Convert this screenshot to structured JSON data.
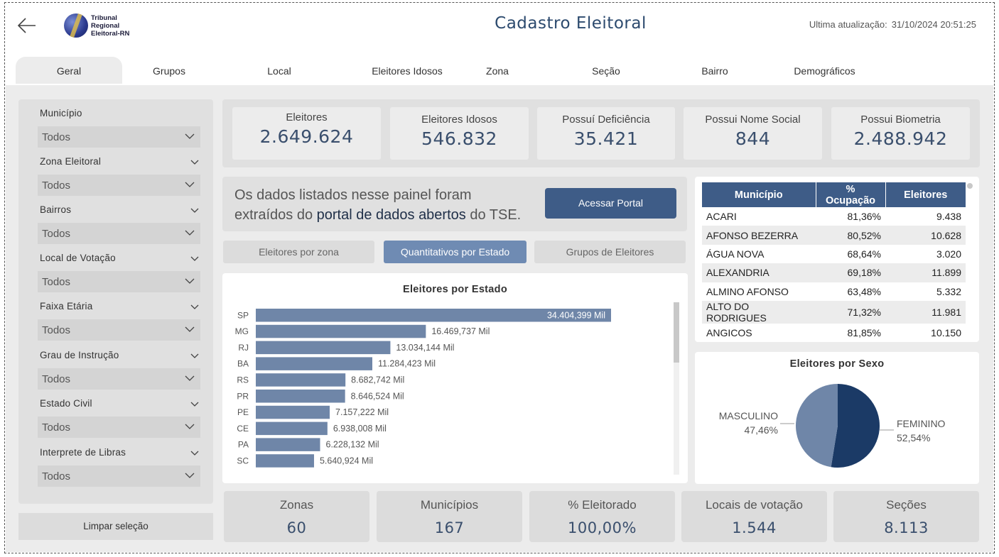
{
  "header": {
    "title": "Cadastro Eleitoral",
    "last_update_label": "Ultima atualização:",
    "last_update_value": "31/10/2024 20:51:25",
    "logo_lines": [
      "Tribunal",
      "Regional",
      "Eleitoral-RN"
    ]
  },
  "tabs": [
    "Geral",
    "Grupos",
    "Local",
    "Eleitores Idosos",
    "Zona",
    "Seção",
    "Bairro",
    "Demográficos"
  ],
  "filters": [
    {
      "label": "Município",
      "value": "Todos"
    },
    {
      "label": "Zona Eleitoral",
      "value": "Todos"
    },
    {
      "label": "Bairros",
      "value": "Todos"
    },
    {
      "label": "Local de Votação",
      "value": "Todos"
    },
    {
      "label": "Faixa Etária",
      "value": "Todos"
    },
    {
      "label": "Grau de Instrução",
      "value": "Todos"
    },
    {
      "label": "Estado Civil",
      "value": "Todos"
    },
    {
      "label": "Interprete de Libras",
      "value": "Todos"
    }
  ],
  "clear_button": "Limpar seleção",
  "kpis_top": [
    {
      "label": "Eleitores",
      "value": "2.649.624"
    },
    {
      "label": "Eleitores Idosos",
      "value": "546.832"
    },
    {
      "label": "Possuí Deficiência",
      "value": "35.421"
    },
    {
      "label": "Possui Nome Social",
      "value": "844"
    },
    {
      "label": "Possui Biometria",
      "value": "2.488.942"
    }
  ],
  "info": {
    "text_before": "Os dados listados nesse painel foram extraídos do ",
    "link_text": "portal de dados abertos",
    "text_after": " do TSE.",
    "button": "Acessar Portal"
  },
  "toggles": [
    "Eleitores por zona",
    "Quantitativos por Estado",
    "Grupos de Eleitores"
  ],
  "chart_data": {
    "type": "bar",
    "orientation": "horizontal",
    "title": "Eleitores por Estado",
    "categories": [
      "SP",
      "MG",
      "RJ",
      "BA",
      "RS",
      "PR",
      "PE",
      "CE",
      "PA",
      "SC"
    ],
    "values": [
      34404.399,
      16469.737,
      13034.144,
      11284.423,
      8682.742,
      8646.524,
      7157.222,
      6938.008,
      6228.132,
      5640.924
    ],
    "labels": [
      "34.404,399 Mil",
      "16.469,737 Mil",
      "13.034,144 Mil",
      "11.284,423 Mil",
      "8.682,742 Mil",
      "8.646,524 Mil",
      "7.157,222 Mil",
      "6.938,008 Mil",
      "6.228,132 Mil",
      "5.640,924 Mil"
    ],
    "bar_color": "#6f86a8"
  },
  "table": {
    "headers": [
      "Município",
      "% Ocupação",
      "Eleitores"
    ],
    "rows": [
      [
        "ACARI",
        "81,36%",
        "9.438"
      ],
      [
        "AFONSO BEZERRA",
        "80,52%",
        "10.628"
      ],
      [
        "ÁGUA NOVA",
        "68,64%",
        "3.020"
      ],
      [
        "ALEXANDRIA",
        "69,18%",
        "11.899"
      ],
      [
        "ALMINO AFONSO",
        "63,48%",
        "5.332"
      ],
      [
        "ALTO DO RODRIGUES",
        "71,32%",
        "11.981"
      ],
      [
        "ANGICOS",
        "81,85%",
        "10.150"
      ]
    ]
  },
  "pie": {
    "title": "Eleitores por Sexo",
    "slices": [
      {
        "label": "MASCULINO",
        "pct_text": "47,46%",
        "value": 47.46,
        "color": "#6f86a8"
      },
      {
        "label": "FEMININO",
        "pct_text": "52,54%",
        "value": 52.54,
        "color": "#1b3a66"
      }
    ]
  },
  "kpis_bottom": [
    {
      "label": "Zonas",
      "value": "60"
    },
    {
      "label": "Municípios",
      "value": "167"
    },
    {
      "label": "% Eleitorado",
      "value": "100,00%"
    },
    {
      "label": "Locais de votação",
      "value": "1.544"
    },
    {
      "label": "Seções",
      "value": "8.113"
    }
  ]
}
